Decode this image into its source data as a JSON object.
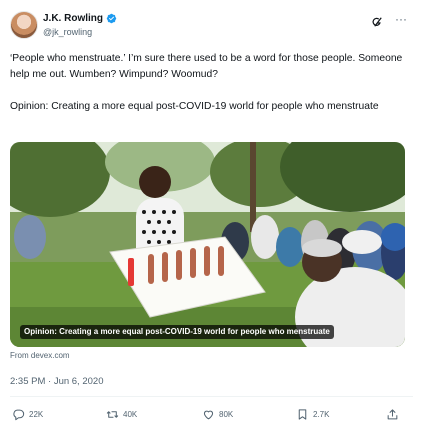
{
  "author": {
    "display_name": "J.K. Rowling",
    "handle": "@jk_rowling",
    "verified": true,
    "verified_color": "#1d9bf0"
  },
  "header_icons": {
    "grok": "grok-icon",
    "more": "···"
  },
  "tweet": {
    "text": "‘People who menstruate.’ I’m sure there used to be a word for those people. Someone help me out. Wumben? Wimpund? Woomud?",
    "quoted_title": "Opinion: Creating a more equal post-COVID-19 world for people who menstruate"
  },
  "card": {
    "caption": "Opinion: Creating a more equal post-COVID-19 world for people who menstruate",
    "source": "From devex.com"
  },
  "timestamp": "2:35 PM · Jun 6, 2020",
  "actions": {
    "replies": "22K",
    "retweets": "40K",
    "likes": "80K",
    "bookmarks": "2.7K"
  },
  "colors": {
    "text": "#0f1419",
    "secondary": "#536471",
    "accent": "#1d9bf0"
  }
}
